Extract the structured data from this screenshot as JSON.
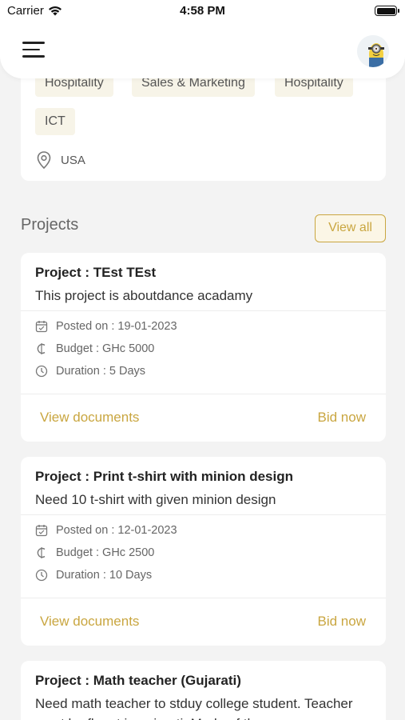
{
  "status_bar": {
    "carrier": "Carrier",
    "time": "4:58 PM"
  },
  "header": {
    "menu_icon": "hamburger-icon",
    "avatar_icon": "minion-avatar"
  },
  "profile": {
    "tags": [
      "Hospitality",
      "Sales & Marketing",
      "Hospitality",
      "ICT"
    ],
    "location": "USA"
  },
  "projects_section": {
    "title": "Projects",
    "view_all_label": "View all"
  },
  "projects": [
    {
      "title": "Project : TEst TEst",
      "description": "This project is aboutdance acadamy",
      "posted_on": "Posted on : 19-01-2023",
      "budget": "Budget : GHc 5000",
      "duration": "Duration : 5 Days",
      "docs_label": "View documents",
      "bid_label": "Bid now"
    },
    {
      "title": "Project : Print t-shirt with minion design",
      "description": "Need 10 t-shirt with given minion design",
      "posted_on": "Posted on : 12-01-2023",
      "budget": "Budget : GHc 2500",
      "duration": "Duration : 10 Days",
      "docs_label": "View documents",
      "bid_label": "Bid now"
    },
    {
      "title": "Project : Math teacher (Gujarati)",
      "description": "Need math teacher to stduy college student. Teacher must  be fluent in gujarati. Mode of the"
    }
  ],
  "colors": {
    "accent": "#c9a640",
    "tag_bg": "#f7f4e8",
    "background": "#f3f3f3"
  }
}
